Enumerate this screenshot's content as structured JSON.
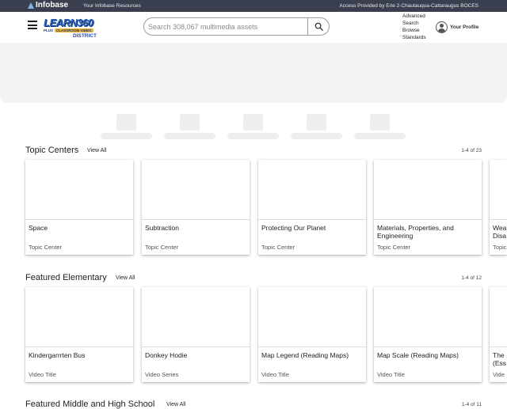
{
  "topbar": {
    "logo_text": "Infobase",
    "resources": "Your Infobase Resources",
    "access": "Access Provided by Erie 2-Chautauqua-Cattaraugus BOCES"
  },
  "brand": {
    "word": "LEARN360",
    "plus": "PLUS",
    "classroom": "CLASSROOM VIDEO",
    "district": "DISTRICT"
  },
  "search": {
    "placeholder": "Search 308,067 multimedia assets",
    "icon": "search-icon"
  },
  "nav_links": [
    "Advanced",
    "Search",
    "Browse",
    "Standards"
  ],
  "profile": {
    "label": "Your Profile",
    "icon": "user-circle-icon"
  },
  "sections": [
    {
      "title": "Topic Centers",
      "view_all": "View All",
      "count": "1-4 of 23",
      "cards": [
        {
          "title": "Space",
          "type": "Topic Center"
        },
        {
          "title": "Subtraction",
          "type": "Topic Center"
        },
        {
          "title": "Protecting Our Planet",
          "type": "Topic Center"
        },
        {
          "title": "Materials, Properties, and Engineering",
          "type": "Topic Center"
        },
        {
          "title": "Wea Disa",
          "type": "Topic"
        }
      ]
    },
    {
      "title": "Featured Elementary",
      "view_all": "View All",
      "count": "1-4 of 12",
      "cards": [
        {
          "title": "Kindergarrrten Bus",
          "type": "Video Title"
        },
        {
          "title": "Donkey Hodie",
          "type": "Video Series"
        },
        {
          "title": "Map Legend (Reading Maps)",
          "type": "Video Title"
        },
        {
          "title": "Map Scale (Reading Maps)",
          "type": "Video Title"
        },
        {
          "title": "The (Ess",
          "type": "Vide"
        }
      ]
    },
    {
      "title": "Featured Middle and High School",
      "view_all": "View All",
      "count": "1-4 of 11"
    }
  ],
  "colors": {
    "topbar": "#3a3f4f",
    "brand_blue": "#2a61b8",
    "banner": "#f3f3f3"
  }
}
